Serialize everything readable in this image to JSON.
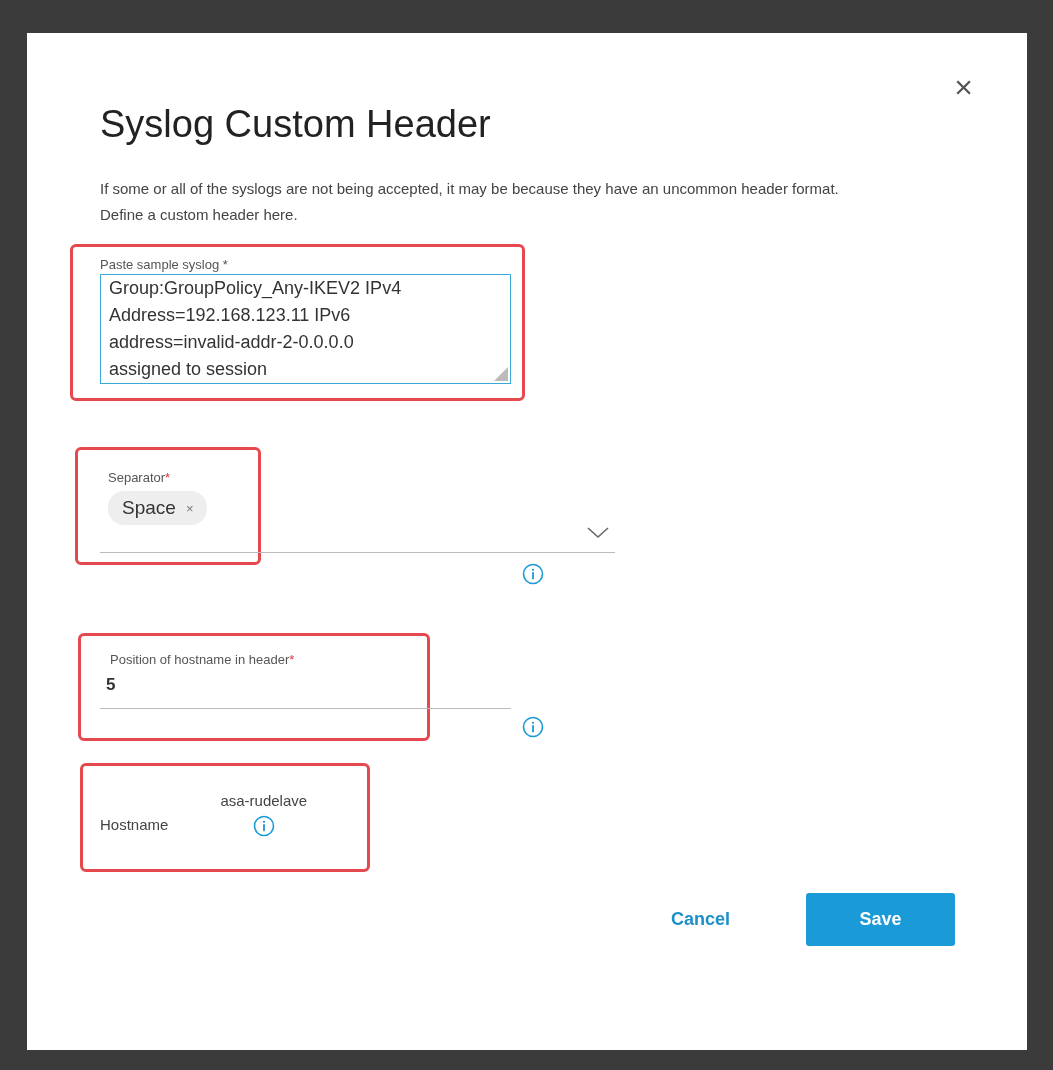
{
  "dialog": {
    "title": "Syslog Custom Header",
    "close": "×",
    "description": "If some or all of the syslogs are not being accepted, it may be because they have an uncommon header format. Define a custom header here."
  },
  "sample_syslog": {
    "label": "Paste sample syslog *",
    "lines": [
      "Group:GroupPolicy_Any-IKEV2 IPv4",
      "Address=192.168.123.11 IPv6",
      "address=invalid-addr-2-0.0.0.0",
      "assigned to session"
    ],
    "highlighted": true
  },
  "separator": {
    "label": "Separator",
    "required_mark": "*",
    "chip": "Space",
    "chip_remove": "×",
    "highlighted": true
  },
  "position": {
    "label": "Position of hostname in header",
    "required_mark": "*",
    "value": "5",
    "highlighted": true
  },
  "hostname": {
    "label": "Hostname",
    "value": "asa-rudelave",
    "highlighted": true
  },
  "buttons": [
    {
      "label": "Cancel",
      "kind": "link"
    },
    {
      "label": "Save",
      "kind": "primary"
    }
  ]
}
